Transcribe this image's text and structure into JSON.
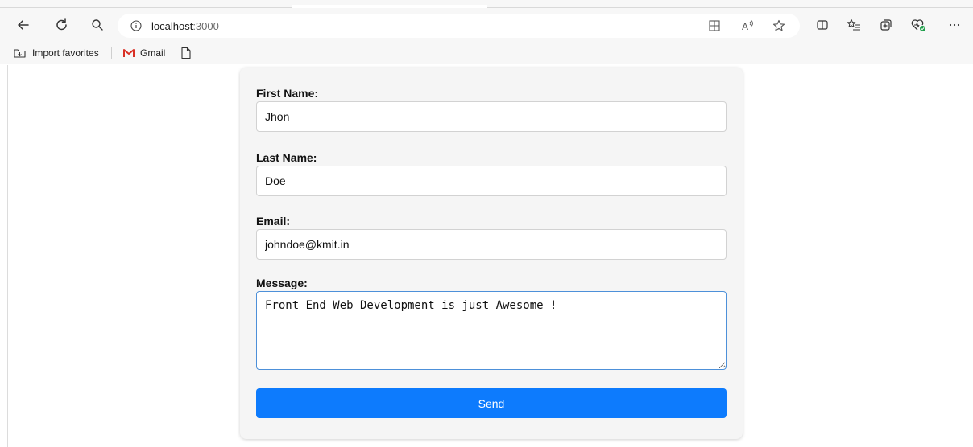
{
  "browser": {
    "address": {
      "host": "localhost",
      "port": ":3000"
    },
    "favorites": [
      {
        "label": "Import favorites",
        "icon": "import-favorites-icon"
      },
      {
        "label": "Gmail",
        "icon": "gmail-icon"
      },
      {
        "label": "",
        "icon": "page-icon"
      }
    ],
    "colors": {
      "chrome_bg": "#f7f7f7",
      "gmail_red": "#d93025",
      "collections_green": "#1e9e4a"
    }
  },
  "form": {
    "first_name": {
      "label": "First Name:",
      "value": "Jhon"
    },
    "last_name": {
      "label": "Last Name:",
      "value": "Doe"
    },
    "email": {
      "label": "Email:",
      "value": "johndoe@kmit.in"
    },
    "message": {
      "label": "Message:",
      "value": "Front End Web Development is just Awesome !"
    },
    "submit_label": "Send",
    "colors": {
      "card_bg": "#f5f5f5",
      "button_bg": "#0d7bfd",
      "focus_border": "#4d90d9"
    }
  }
}
